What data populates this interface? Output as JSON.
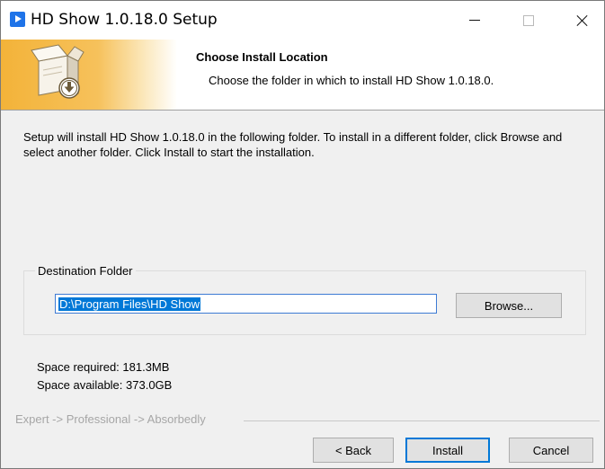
{
  "window": {
    "title": "HD Show 1.0.18.0 Setup",
    "app_icon": "play-icon",
    "controls": {
      "minimize": "minimize-icon",
      "maximize": "maximize-icon",
      "close": "close-icon"
    }
  },
  "header": {
    "title": "Choose Install Location",
    "subtitle": "Choose the folder in which to install HD Show 1.0.18.0.",
    "banner_icon": "install-box-icon",
    "banner_color": "#f3b339"
  },
  "body": {
    "description": "Setup will install HD Show 1.0.18.0 in the following folder. To install in a different folder, click Browse and select another folder. Click Install to start the installation.",
    "destination": {
      "legend": "Destination Folder",
      "path_value": "D:\\Program Files\\HD Show",
      "browse_label": "Browse..."
    },
    "space_required": "Space required: 181.3MB",
    "space_available": "Space available: 373.0GB"
  },
  "footer": {
    "branding": "Expert -> Professional -> Absorbedly",
    "back_label": "< Back",
    "install_label": "Install",
    "cancel_label": "Cancel"
  },
  "colors": {
    "selection": "#0078d7",
    "accent_border": "#0078d7"
  }
}
